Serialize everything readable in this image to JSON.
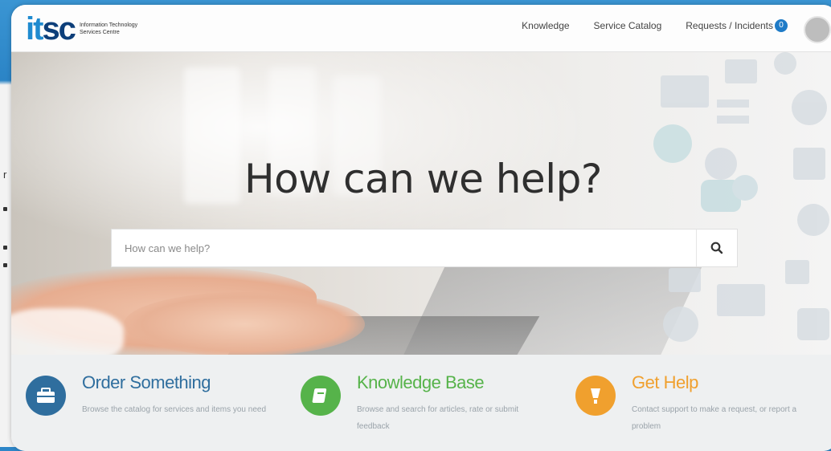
{
  "header": {
    "logo_primary": "it",
    "logo_secondary": "sc",
    "logo_subtitle": "Information Technology Services Centre",
    "nav": [
      {
        "label": "Knowledge"
      },
      {
        "label": "Service Catalog"
      },
      {
        "label": "Requests / Incidents"
      }
    ],
    "requests_badge": "0"
  },
  "hero": {
    "heading": "How can we help?",
    "search_placeholder": "How can we help?"
  },
  "cards": [
    {
      "title": "Order Something",
      "description": "Browse the catalog for services and items you need",
      "color": "#2f6e9e",
      "icon": "briefcase-icon"
    },
    {
      "title": "Knowledge Base",
      "description": "Browse and search for articles, rate or submit feedback",
      "color": "#56b34a",
      "icon": "book-icon"
    },
    {
      "title": "Get Help",
      "description": "Contact support to make a request, or report a problem",
      "color": "#f0a02e",
      "icon": "exclamation-icon"
    }
  ],
  "colors": {
    "brand_light": "#1f8bd0",
    "brand_dark": "#0d3f7a"
  }
}
